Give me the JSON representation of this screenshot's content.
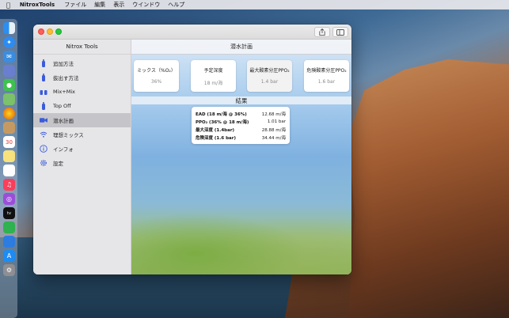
{
  "menubar": {
    "app_name": "NitroxTools",
    "menus": [
      "ファイル",
      "編集",
      "表示",
      "ウインドウ",
      "ヘルプ"
    ]
  },
  "dock": {
    "icons": [
      "finder-icon",
      "safari-icon",
      "mail-icon",
      "messages-icon",
      "maps-icon",
      "photos-icon",
      "contacts-icon",
      "calendar-icon",
      "notes-icon",
      "reminders-icon",
      "music-icon",
      "podcasts-icon",
      "tv-icon",
      "numbers-icon",
      "keynote-icon",
      "app-store-icon",
      "settings-icon"
    ]
  },
  "window": {
    "sidebar_title": "Nitrox Tools",
    "main_title": "潜水計画",
    "sidebar_items": [
      {
        "label": "追加方法",
        "icon": "tank-icon"
      },
      {
        "label": "抜出す方法",
        "icon": "tank-icon"
      },
      {
        "label": "Mix+Mix",
        "icon": "mix-icon"
      },
      {
        "label": "Top Off",
        "icon": "tank-icon"
      },
      {
        "label": "潜水計画",
        "icon": "camera-icon",
        "selected": true
      },
      {
        "label": "理想ミックス",
        "icon": "wifi-icon"
      },
      {
        "label": "インフォ",
        "icon": "info-icon"
      },
      {
        "label": "設定",
        "icon": "gear-icon"
      }
    ],
    "cards": [
      {
        "label": "ミックス（%O₂）",
        "value": "36%"
      },
      {
        "label": "予定深度",
        "value": "18 m/海"
      },
      {
        "label": "最大酸素分圧PPO₂",
        "value": "1.4 bar"
      },
      {
        "label": "危険酸素分圧PPO₂",
        "value": "1.6 bar"
      }
    ],
    "results_header": "結果",
    "results": [
      {
        "label": "EAD (18 m/海 @ 36%)",
        "value": "12.68 m/海"
      },
      {
        "label": "PPO₂ (36% @ 18 m/海)",
        "value": "1.01 bar"
      },
      {
        "label": "最大深度 (1.4bar)",
        "value": "28.88 m/海"
      },
      {
        "label": "危険深度 (1.6 bar)",
        "value": "34.44 m/海"
      }
    ]
  }
}
